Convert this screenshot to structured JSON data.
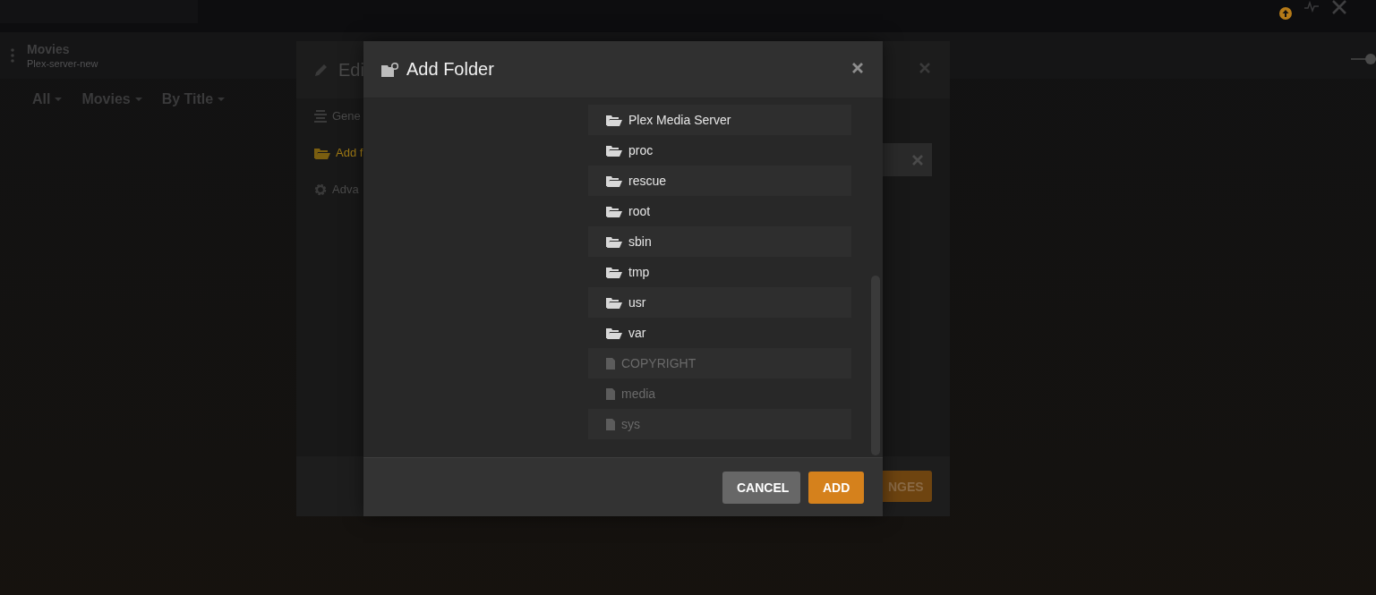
{
  "header": {
    "title": "Movies",
    "subtitle": "Plex-server-new",
    "size_slider": {
      "level": 1
    }
  },
  "filters": [
    {
      "label": "All"
    },
    {
      "label": "Movies"
    },
    {
      "label": "By Title"
    }
  ],
  "edit_dialog": {
    "title": "Edi",
    "sidebar": [
      {
        "label": "Gene",
        "selected": false
      },
      {
        "label": "Add f",
        "selected": true
      },
      {
        "label": "Adva",
        "selected": false
      }
    ],
    "save_button": "NGES"
  },
  "add_folder_dialog": {
    "title": "Add Folder",
    "entries": [
      {
        "name": "Plex Media Server",
        "kind": "folder"
      },
      {
        "name": "proc",
        "kind": "folder"
      },
      {
        "name": "rescue",
        "kind": "folder"
      },
      {
        "name": "root",
        "kind": "folder"
      },
      {
        "name": "sbin",
        "kind": "folder"
      },
      {
        "name": "tmp",
        "kind": "folder"
      },
      {
        "name": "usr",
        "kind": "folder"
      },
      {
        "name": "var",
        "kind": "folder"
      },
      {
        "name": "COPYRIGHT",
        "kind": "file"
      },
      {
        "name": "media",
        "kind": "file"
      },
      {
        "name": "sys",
        "kind": "file"
      }
    ],
    "buttons": [
      {
        "label": "CANCEL",
        "kind": "secondary"
      },
      {
        "label": "ADD",
        "kind": "primary"
      }
    ]
  }
}
